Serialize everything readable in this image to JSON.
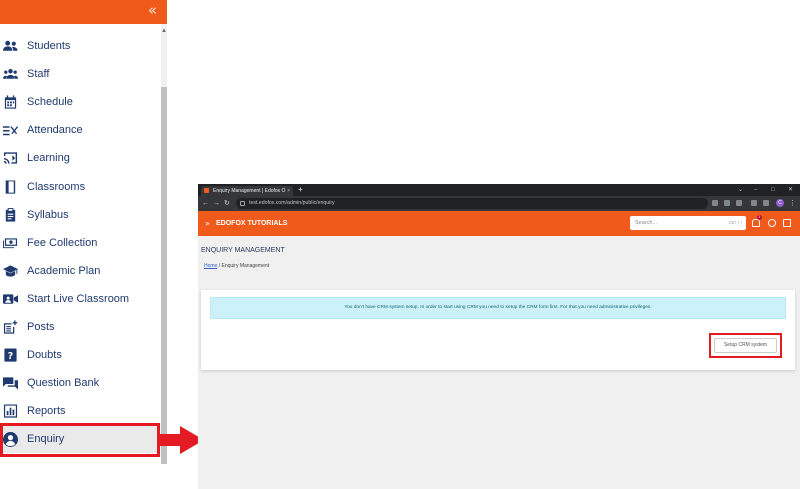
{
  "sidebar": {
    "collapse_icon": "double-chevron-left-icon",
    "items": [
      {
        "label": "Students",
        "icon": "users-icon"
      },
      {
        "label": "Staff",
        "icon": "staff-group-icon"
      },
      {
        "label": "Schedule",
        "icon": "calendar-icon"
      },
      {
        "label": "Attendance",
        "icon": "attendance-check-icon"
      },
      {
        "label": "Learning",
        "icon": "cast-screen-icon"
      },
      {
        "label": "Classrooms",
        "icon": "book-icon"
      },
      {
        "label": "Syllabus",
        "icon": "clipboard-icon"
      },
      {
        "label": "Fee Collection",
        "icon": "money-bill-icon"
      },
      {
        "label": "Academic Plan",
        "icon": "graduation-cap-icon"
      },
      {
        "label": "Start Live Classroom",
        "icon": "video-camera-icon"
      },
      {
        "label": "Posts",
        "icon": "post-add-icon"
      },
      {
        "label": "Doubts",
        "icon": "question-box-icon"
      },
      {
        "label": "Question Bank",
        "icon": "chat-bubbles-icon"
      },
      {
        "label": "Reports",
        "icon": "bar-chart-icon"
      },
      {
        "label": "Enquiry",
        "icon": "user-circle-icon"
      }
    ]
  },
  "browser": {
    "tab_title": "Enquiry Management | Edofox O",
    "tab_close": "×",
    "new_tab": "+",
    "url": "test.edofox.com/admin/public/enquiry",
    "profile_initial": "C"
  },
  "app": {
    "title": "EDOFOX TUTORIALS",
    "search_placeholder": "Search...",
    "search_shortcut": "Ctrl + /",
    "notification_count": "1"
  },
  "page": {
    "heading": "ENQUIRY MANAGEMENT",
    "breadcrumb_home": "Home",
    "breadcrumb_sep": "/",
    "breadcrumb_current": "Enquiry Management",
    "alert_text": "You don't have CRM system setup. In order to start using CRM you need to setup the CRM form first. For that you need administrative privileges.",
    "setup_button": "Setup CRM system"
  },
  "colors": {
    "brand_orange": "#f05a1a",
    "menu_text": "#1f3a6e",
    "highlight_red": "#e41b23",
    "alert_bg": "#cdf1f9"
  }
}
